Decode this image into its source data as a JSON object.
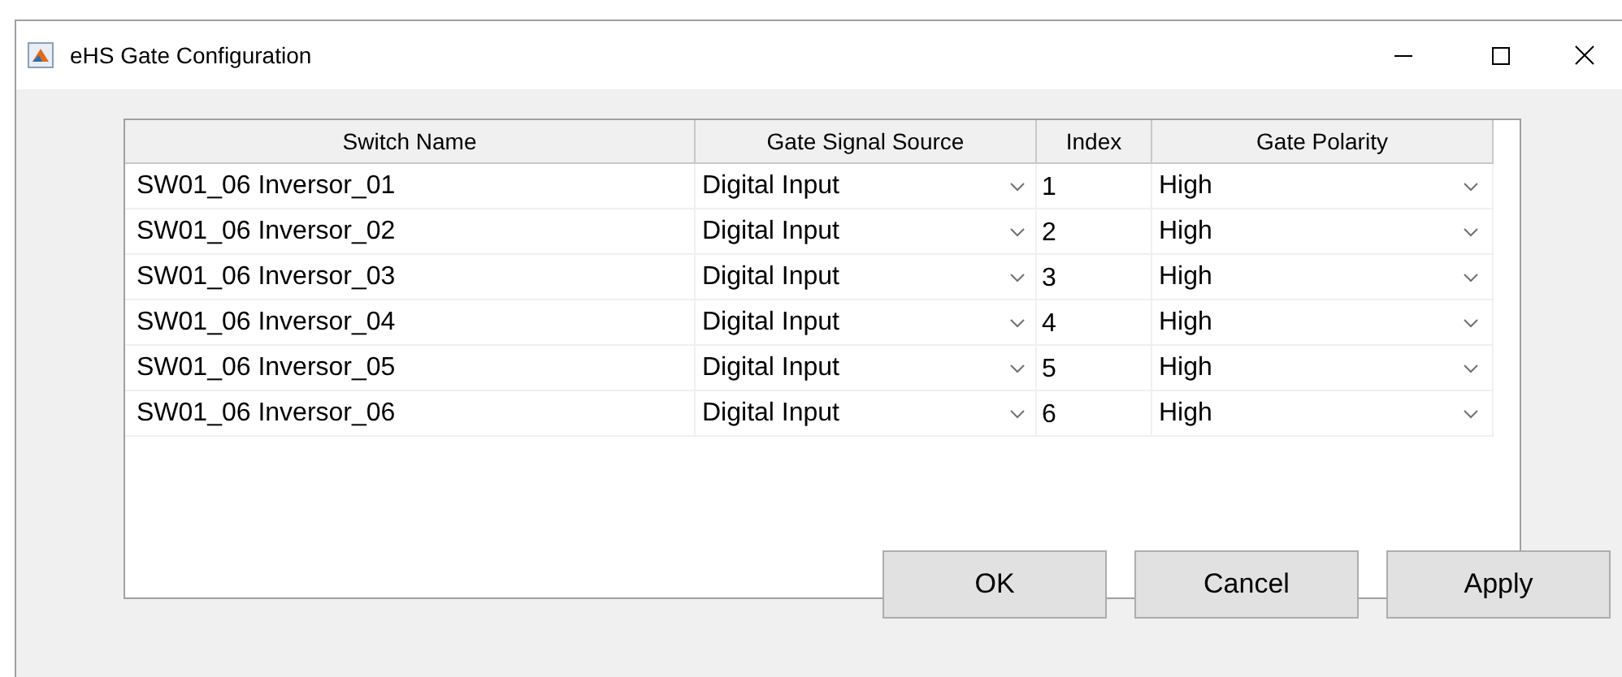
{
  "window": {
    "title": "eHS Gate Configuration"
  },
  "table": {
    "columns": [
      "Switch Name",
      "Gate Signal Source",
      "Index",
      "Gate Polarity"
    ],
    "rows": [
      {
        "switch_name": "SW01_06 Inversor_01",
        "gate_signal_source": "Digital Input",
        "index": "1",
        "gate_polarity": "High"
      },
      {
        "switch_name": "SW01_06 Inversor_02",
        "gate_signal_source": "Digital Input",
        "index": "2",
        "gate_polarity": "High"
      },
      {
        "switch_name": "SW01_06 Inversor_03",
        "gate_signal_source": "Digital Input",
        "index": "3",
        "gate_polarity": "High"
      },
      {
        "switch_name": "SW01_06 Inversor_04",
        "gate_signal_source": "Digital Input",
        "index": "4",
        "gate_polarity": "High"
      },
      {
        "switch_name": "SW01_06 Inversor_05",
        "gate_signal_source": "Digital Input",
        "index": "5",
        "gate_polarity": "High"
      },
      {
        "switch_name": "SW01_06 Inversor_06",
        "gate_signal_source": "Digital Input",
        "index": "6",
        "gate_polarity": "High"
      }
    ]
  },
  "buttons": [
    "OK",
    "Cancel",
    "Apply"
  ]
}
